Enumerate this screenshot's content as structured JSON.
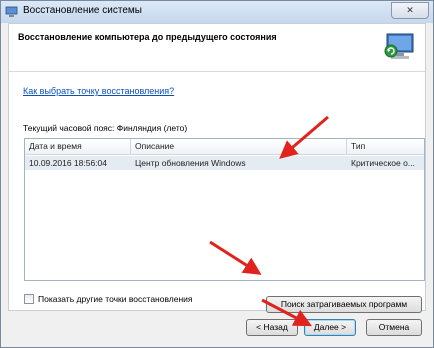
{
  "window": {
    "title": "Восстановление системы",
    "close_label": "✕"
  },
  "header": {
    "title": "Восстановление компьютера до предыдущего состояния"
  },
  "help_link": "Как выбрать точку восстановления?",
  "timezone_label": "Текущий часовой пояс: Финляндия (лето)",
  "table": {
    "columns": [
      "Дата и время",
      "Описание",
      "Тип"
    ],
    "rows": [
      {
        "date": "10.09.2016 18:56:04",
        "description": "Центр обновления Windows",
        "type": "Критическое о..."
      }
    ]
  },
  "show_more_label": "Показать другие точки восстановления",
  "buttons": {
    "search": "Поиск затрагиваемых программ",
    "back": "< Назад",
    "next": "Далее >",
    "cancel": "Отмена"
  },
  "colors": {
    "annotation_arrow": "#e0231c",
    "link": "#0b50b8",
    "selected_row": "#e5ebf2"
  }
}
